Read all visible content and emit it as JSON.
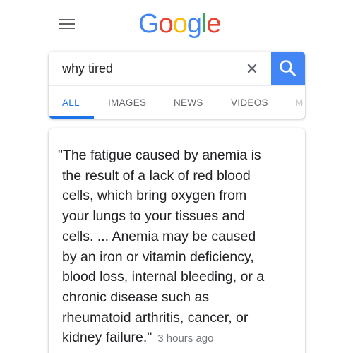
{
  "header": {
    "menu_icon": "hamburger-menu-icon",
    "logo": {
      "letters": [
        {
          "char": "G",
          "color": "#4285F4"
        },
        {
          "char": "o",
          "color": "#EA4335"
        },
        {
          "char": "o",
          "color": "#FBBC05"
        },
        {
          "char": "g",
          "color": "#4285F4"
        },
        {
          "char": "l",
          "color": "#34A853"
        },
        {
          "char": "e",
          "color": "#EA4335"
        }
      ]
    }
  },
  "search": {
    "query": "why tired",
    "clear_icon": "close-icon",
    "search_icon": "search-icon",
    "accent_color": "#4285F4"
  },
  "tabs": [
    {
      "label": "ALL",
      "active": true
    },
    {
      "label": "IMAGES",
      "active": false
    },
    {
      "label": "NEWS",
      "active": false
    },
    {
      "label": "VIDEOS",
      "active": false
    },
    {
      "label": "M",
      "active": false
    }
  ],
  "result": {
    "lines": [
      "\"The fatigue caused by anemia is",
      "the result of a lack of red blood",
      "cells, which bring oxygen from",
      "your lungs to your tissues and",
      "cells. ... Anemia may be caused",
      "by an iron or vitamin deficiency,",
      "blood loss, internal bleeding, or a",
      "chronic disease such as",
      "rheumatoid arthritis, cancer, or",
      "kidney failure.\""
    ],
    "timestamp": "3 hours ago"
  },
  "colors": {
    "active_tab": "#1A73E8",
    "inactive_tab": "#5F6368",
    "body_text": "#202124",
    "timestamp": "#70757A"
  }
}
